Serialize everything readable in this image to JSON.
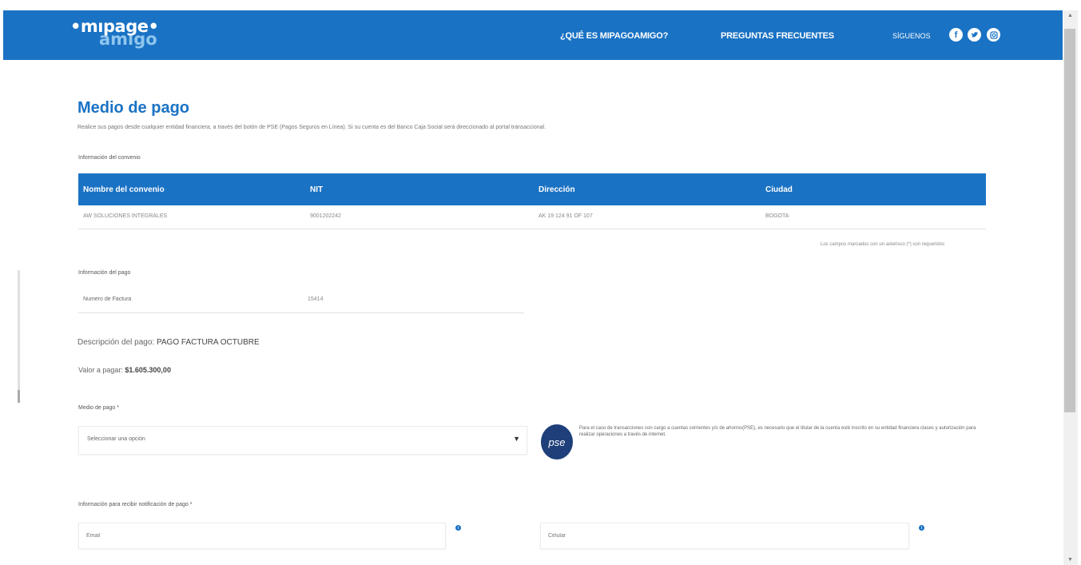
{
  "header": {
    "logo_line1": "•mıpage•",
    "logo_line2": "amıgo",
    "nav": [
      "¿QUÉ ES MIPAGOAMIGO?",
      "PREGUNTAS FRECUENTES"
    ],
    "follow_label": "SÍGUENOS",
    "social_icons": [
      "facebook-icon",
      "twitter-icon",
      "instagram-icon"
    ]
  },
  "page": {
    "title": "Medio de pago",
    "intro": "Realice sus pagos desde cualquier entidad financiera, a través del botón de PSE (Pagos Seguros en Línea). Si su cuenta es del Banco Caja Social será direccionado al portal transaccional."
  },
  "convenio": {
    "label": "Información del convenio",
    "headers": [
      "Nombre del convenio",
      "NIT",
      "Dirección",
      "Ciudad"
    ],
    "row": [
      "AW SOLUCIONES INTEGRALES",
      "9001202242",
      "AK 19 124 91 OF 107",
      "BOGOTA"
    ]
  },
  "required_note": "Los campos marcados con un asterisco (*) son requeridos",
  "pago": {
    "label": "Información del pago",
    "invoice_label": "Numero de Factura",
    "invoice_value": "15414",
    "desc_label": "Descripción del pago:",
    "desc_value": "PAGO FACTURA OCTUBRE",
    "valor_label": "Valor a pagar:",
    "valor_value": "$1.605.300,00"
  },
  "medio": {
    "label": "Medio de pago *",
    "select_placeholder": "Seleccionar una opción",
    "pse_logo_text": "pse",
    "pse_note": "Para el caso de transacciones con cargo a cuentas corrientes y/o de ahorros(PSE), es necesario que el titular de la cuenta esté inscrito en su entidad financiera clases y autorización para realizar operaciones a través de internet."
  },
  "notificacion": {
    "label": "Información para recibir notificación de pago *",
    "email_placeholder": "Email",
    "celular_placeholder": "Celular"
  },
  "colors": {
    "primary": "#1a72c4",
    "pse": "#1e3f7a"
  }
}
